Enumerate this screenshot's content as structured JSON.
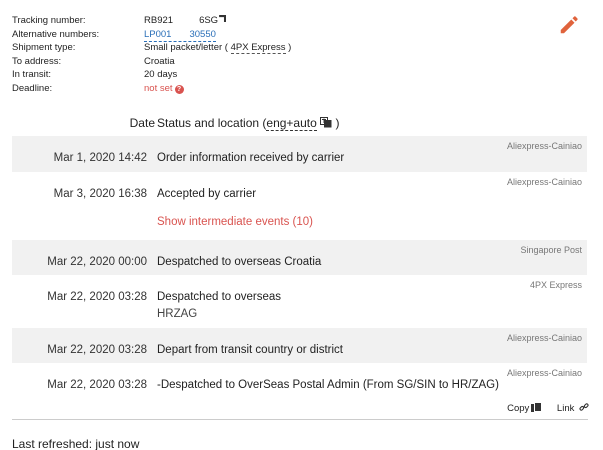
{
  "info": {
    "tracking_label": "Tracking number:",
    "tracking_value_start": "RB921",
    "tracking_value_end": "6SG",
    "alt_label": "Alternative numbers:",
    "alt_value_start": "LP001",
    "alt_value_end": "30550",
    "type_label": "Shipment type:",
    "type_value": "Small packet/letter (",
    "type_service": "4PX Express",
    "type_close": ")",
    "address_label": "To address:",
    "address_value": "Croatia",
    "transit_label": "In transit:",
    "transit_value": "20 days",
    "deadline_label": "Deadline:",
    "deadline_value": "not set",
    "deadline_help": "?"
  },
  "table": {
    "date_header": "Date",
    "status_header_prefix": "Status and location (",
    "status_header_lang": "eng+auto",
    "status_header_suffix": ")"
  },
  "events": [
    {
      "date": "Mar 1, 2020 14:42",
      "status": "Order information received by carrier",
      "sub": "",
      "source": "Aliexpress-Cainiao"
    },
    {
      "date": "Mar 3, 2020 16:38",
      "status": "Accepted by carrier",
      "sub": "",
      "source": "Aliexpress-Cainiao"
    },
    {
      "date": "Mar 22, 2020 00:00",
      "status": "Despatched to overseas Croatia",
      "sub": "",
      "source": "Singapore Post"
    },
    {
      "date": "Mar 22, 2020 03:28",
      "status": "Despatched to overseas",
      "sub": "HRZAG",
      "source": "4PX Express"
    },
    {
      "date": "Mar 22, 2020 03:28",
      "status": "Depart from transit country or district",
      "sub": "",
      "source": "Aliexpress-Cainiao"
    },
    {
      "date": "Mar 22, 2020 03:28",
      "status": "-Despatched to OverSeas Postal Admin (From SG/SIN to HR/ZAG)",
      "sub": "",
      "source": "Aliexpress-Cainiao"
    }
  ],
  "show_more": "Show intermediate events (10)",
  "tools": {
    "copy_label": "Copy",
    "link_label": "Link"
  },
  "footer": {
    "refreshed": "Last refreshed: just now"
  },
  "colors": {
    "accent_red": "#d9534f",
    "link_blue": "#2a6fb8",
    "row_shade": "#f1f1f1"
  }
}
